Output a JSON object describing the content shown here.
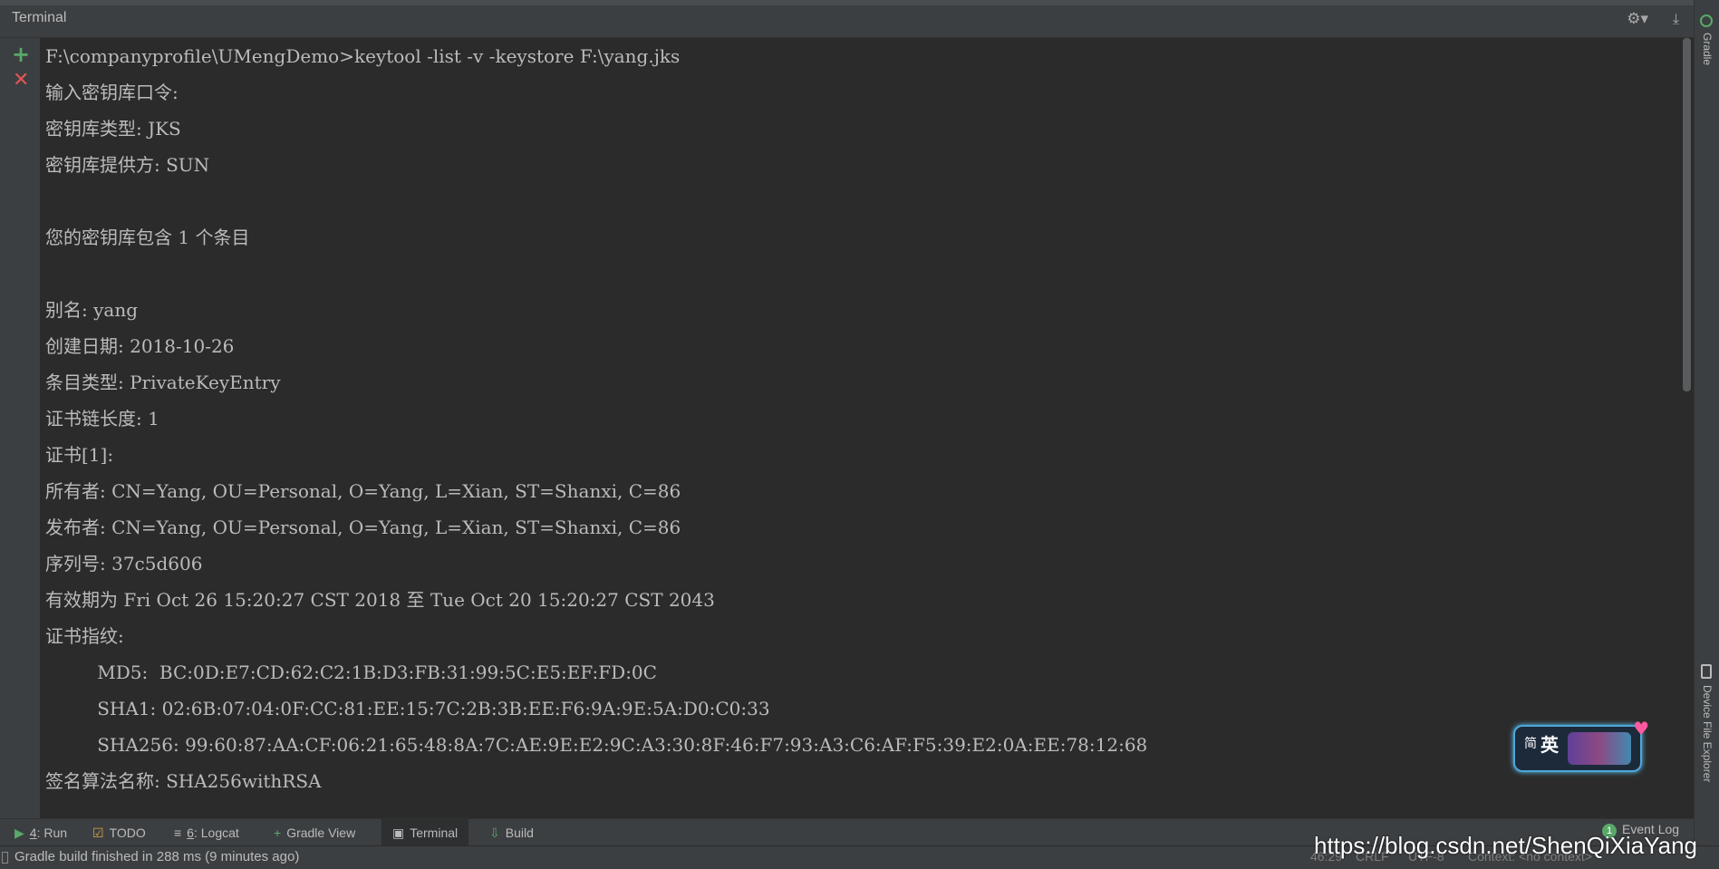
{
  "panel": {
    "title": "Terminal"
  },
  "icons": {
    "gear": "gear-icon",
    "hide": "hide-icon",
    "add": "plus-icon",
    "close": "close-icon",
    "scrollbar": "scrollbar"
  },
  "terminal": {
    "lines": [
      "F:\\companyprofile\\UMengDemo>keytool -list -v -keystore F:\\yang.jks",
      "输入密钥库口令:",
      "密钥库类型: JKS",
      "密钥库提供方: SUN",
      "",
      "您的密钥库包含 1 个条目",
      "",
      "别名: yang",
      "创建日期: 2018-10-26",
      "条目类型: PrivateKeyEntry",
      "证书链长度: 1",
      "证书[1]:",
      "所有者: CN=Yang, OU=Personal, O=Yang, L=Xian, ST=Shanxi, C=86",
      "发布者: CN=Yang, OU=Personal, O=Yang, L=Xian, ST=Shanxi, C=86",
      "序列号: 37c5d606",
      "有效期为 Fri Oct 26 15:20:27 CST 2018 至 Tue Oct 20 15:20:27 CST 2043",
      "证书指纹:",
      "         MD5:  BC:0D:E7:CD:62:C2:1B:D3:FB:31:99:5C:E5:EF:FD:0C",
      "         SHA1: 02:6B:07:04:0F:CC:81:EE:15:7C:2B:3B:EE:F6:9A:9E:5A:D0:C0:33",
      "         SHA256: 99:60:87:AA:CF:06:21:65:48:8A:7C:AE:9E:E2:9C:A3:30:8F:46:F7:93:A3:C6:AF:F5:39:E2:0A:EE:78:12:68",
      "签名算法名称: SHA256withRSA"
    ]
  },
  "right_strip": {
    "gradle": "Gradle",
    "device_explorer": "Device File Explorer"
  },
  "tool_tabs": {
    "run_num": "4",
    "run_label": ": Run",
    "todo": "TODO",
    "logcat_num": "6",
    "logcat_label": ": Logcat",
    "gradle_view": "Gradle View",
    "terminal": "Terminal",
    "build": "Build"
  },
  "event_log": {
    "count": "1",
    "label": "Event Log"
  },
  "status_bar": {
    "message": "Gradle build finished in 288 ms (9 minutes ago)",
    "position": "46:29",
    "line_sep": "CRLF",
    "encoding": "UTF-8",
    "context": "Context: <no context>"
  },
  "watermark": "https://blog.csdn.net/ShenQiXiaYang",
  "ime": {
    "mode_small": "简",
    "mode_big": "英"
  }
}
